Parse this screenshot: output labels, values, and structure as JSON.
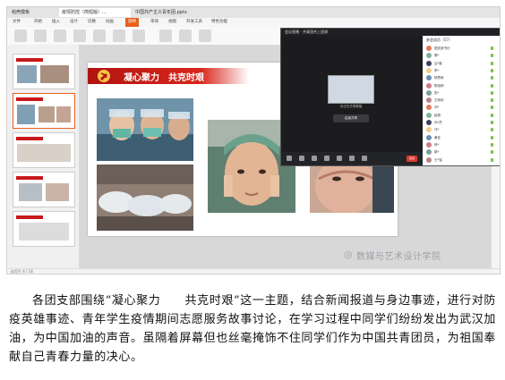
{
  "tabs": [
    "稻壳模板",
    "疫情防控（简短版）…",
    "中国共产主义青年团.pptx"
  ],
  "menus": [
    "文件",
    "开始",
    "插入",
    "设计",
    "切换",
    "动画",
    "幻灯片放映",
    "审阅",
    "视图",
    "开发工具",
    "特色功能"
  ],
  "active_menu": "放映",
  "slide": {
    "title": "凝心聚力　共克时艰"
  },
  "meeting": {
    "window_title": "会议直播 - 共青团共上团课",
    "share_label": "你正在共享屏幕",
    "stop_share": "结束共享",
    "end_button": "结束",
    "participants_header": "参会成员（57）",
    "participants": [
      "团支部书记",
      "周*",
      "吕*豪",
      "李*",
      "杨思雨",
      "陈晓明",
      "张*",
      "王雨欣",
      "刘*",
      "赵丽",
      "孙*杰",
      "马*",
      "黄佳",
      "林*",
      "郭*",
      "王*铭"
    ]
  },
  "status": "幻灯片 4 / 14",
  "watermark": "数媒与艺术设计学院",
  "paragraph": "各团支部围绕“凝心聚力　　共克时艰”这一主题，结合新闻报道与身边事迹，进行对防疫英雄事迹、青年学生疫情期间志愿服务故事讨论，在学习过程中同学们纷纷发出为武汉加油，为中国加油的声音。虽隔着屏幕但也丝毫掩饰不住同学们作为中国共青团员，为祖国奉献自己青春力量的决心。",
  "colors": {
    "accent": "#e8611d",
    "banner_red": "#c8181a"
  }
}
